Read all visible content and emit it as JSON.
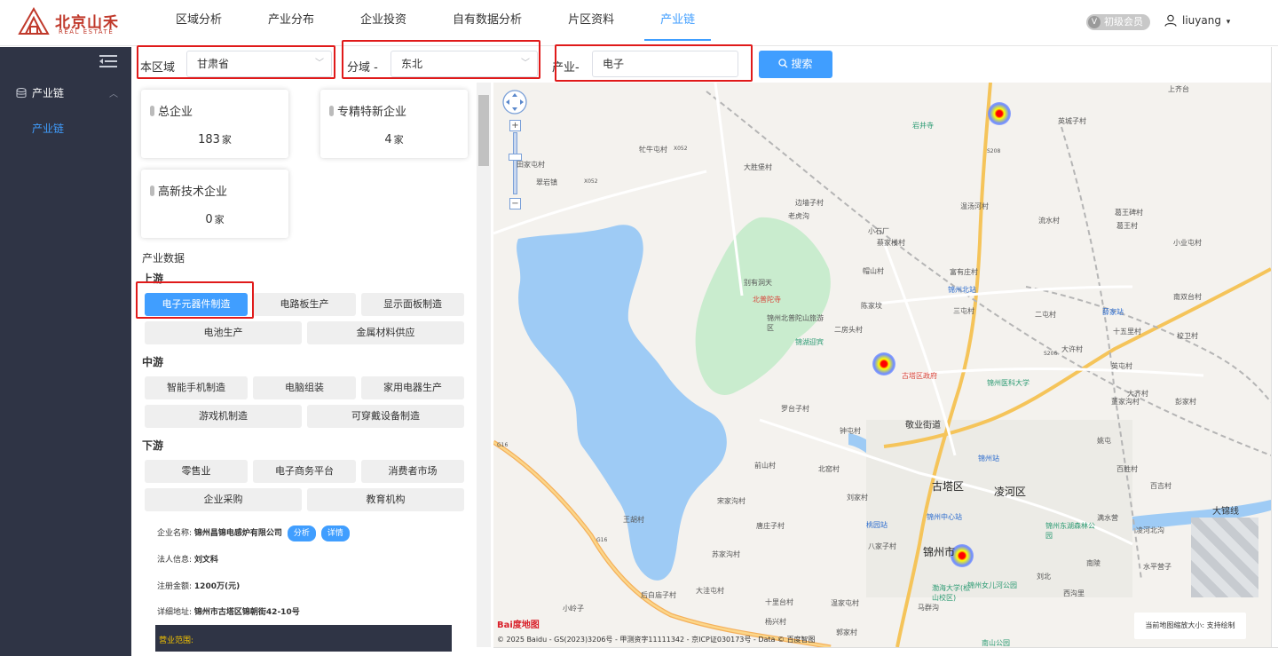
{
  "header": {
    "logo_cn": "北京山禾",
    "logo_en": "REAL ESTATE",
    "nav": [
      "区域分析",
      "产业分布",
      "企业投资",
      "自有数据分析",
      "片区资料",
      "产业链"
    ],
    "member_badge": "初级会员",
    "member_icon": "V",
    "username": "liuyang",
    "user_caret": "▾"
  },
  "sidebar": {
    "group_label": "产业链",
    "group_arrow": "︿",
    "sub_label": "产业链"
  },
  "filters": {
    "region_label": "本区域",
    "region_value": "甘肃省",
    "domain_label": "分域 -",
    "domain_value": "东北",
    "industry_label": "产业-",
    "industry_value": "电子",
    "search_label": "搜索",
    "chevron": "﹀"
  },
  "stats": {
    "total_title": "总企业",
    "total_value": "183",
    "special_title": "专精特新企业",
    "special_value": "4",
    "hightech_title": "高新技术企业",
    "hightech_value": "0",
    "unit": "家"
  },
  "chain": {
    "section_title": "产业数据",
    "upstream_title": "上游",
    "upstream": [
      "电子元器件制造",
      "电路板生产",
      "显示面板制造",
      "电池生产",
      "金属材料供应"
    ],
    "midstream_title": "中游",
    "midstream": [
      "智能手机制造",
      "电脑组装",
      "家用电器生产",
      "游戏机制造",
      "可穿戴设备制造"
    ],
    "downstream_title": "下游",
    "downstream": [
      "零售业",
      "电子商务平台",
      "消费者市场",
      "企业采购",
      "教育机构"
    ]
  },
  "company": {
    "name_label": "企业名称:",
    "name_value": "锦州昌锦电感炉有限公司",
    "analyze_btn": "分析",
    "detail_btn": "详情",
    "legal_label": "法人信息:",
    "legal_value": "刘文科",
    "capital_label": "注册金额:",
    "capital_value": "1200万(元)",
    "address_label": "详细地址:",
    "address_value": "锦州市古塔区锦朝街42-10号",
    "scope_label": "营业范围:"
  },
  "map": {
    "labels": {
      "shangqiancun": "上齐台",
      "yanjingsi": "岩井寺",
      "yingchengzi": "英城子村",
      "xiuniutun": "牤牛屯村",
      "x052a": "X052",
      "tianjiatun": "田家屯村",
      "cuiyanzhen": "翠岩镇",
      "x052b": "X052",
      "dashengbao": "大胜堡村",
      "bianqiang": "边墙子村",
      "laohugou": "老虎沟",
      "wentang": "温汤河村",
      "liushui": "流水村",
      "xiaoshichang": "小石厂",
      "caijialou": "蔡家楼村",
      "gaoliang": "葛王碑村",
      "gegong": "葛王村",
      "xiaoyi": "小业屯村",
      "fuyouzhuang": "富有庄村",
      "bieyou": "别有洞天",
      "beipu": "北普陀寺",
      "beipushan": "锦州北普陀山旅游区",
      "maoshan": "帽山村",
      "jinzhoubei": "锦州北站",
      "chenjia": "陈家坟",
      "shantun": "三屯村",
      "xuejiazhan": "薛家站",
      "erxiang": "二屯村",
      "nanshuang": "南双台村",
      "jinhuyingbin": "锦湖迎宾",
      "erfangtou": "二房头村",
      "shisanli": "十五里村",
      "xiaozhuang": "校卫村",
      "daxu": "大许村",
      "gutaqu_gov": "古塔区政府",
      "jinyike": "锦州医科大学",
      "yingtun": "英屯村",
      "luotai": "罗台子村",
      "jingye": "敬业街道",
      "daqi": "大齐村",
      "pengjia": "彭家村",
      "dongjia": "董家沟村",
      "zhongtun": "钟屯村",
      "jinzhouzhan": "锦州站",
      "yaobao": "姚屯",
      "qianshan": "前山村",
      "beiyao": "北窑村",
      "baisheng": "百胜村",
      "gutaqu": "古塔区",
      "linghequ": "凌河区",
      "baijia": "百吉村",
      "songjia": "宋家沟村",
      "liuqi": "刘家村",
      "jinzhouzhongxin": "锦州中心站",
      "taoyuan": "桃园站",
      "jinzhoudonghu": "锦州东湖森林公园",
      "manshui": "满水营",
      "linghebei": "凌河北沟",
      "dajinxian": "大锦线",
      "wanghu": "王胡村",
      "tangzhuang": "唐庄子村",
      "baojia": "八家子村",
      "jinzhoushi": "锦州市",
      "nanling": "南陵",
      "shuiping": "水平营子",
      "sujia": "苏家沟村",
      "bohaidaxue": "渤海大学(松山校区)",
      "jinzhounvershan": "锦州女儿河公园",
      "dazhen": "大洼屯村",
      "shili": "十里台村",
      "wenjia": "温家屯村",
      "majia": "马群沟",
      "liubei": "刘北",
      "xigou": "西沟里",
      "houbai": "后白庙子村",
      "xiaolingzi": "小岭子",
      "yangxing": "杨兴村",
      "guojia": "郭家村",
      "nanshan": "南山公园",
      "g16a": "G16",
      "g16b": "G16",
      "s208": "S208",
      "s206": "S206"
    },
    "zoom_plus": "+",
    "zoom_minus": "−",
    "baidu_logo": "Bai度地图",
    "copyright": "© 2025 Baidu - GS(2023)3206号 - 甲测资字11111342 - 京ICP证030173号 - Data © 百度智图",
    "size_tip": "当前地图缩放大小: 支持绘制"
  }
}
